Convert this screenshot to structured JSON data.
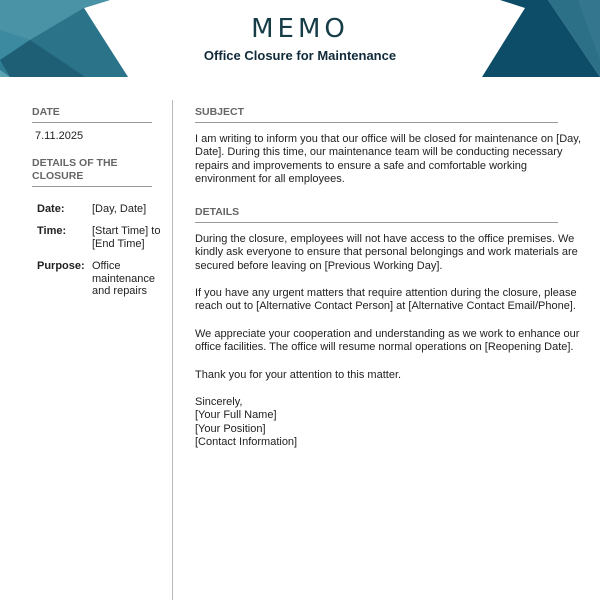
{
  "header": {
    "title": "MEMO",
    "subtitle": "Office Closure for Maintenance",
    "colors": {
      "teal": "#3a8296",
      "teal_light": "#4a93a6",
      "navy": "#0f4e68",
      "teal_dark": "#1d6279"
    }
  },
  "left": {
    "date_heading": "DATE",
    "date_value": "7.11.2025",
    "details_heading_line1": "DETAILS OF THE",
    "details_heading_line2": "CLOSURE",
    "details": [
      {
        "label": "Date:",
        "value_lines": [
          "[Day, Date]"
        ]
      },
      {
        "label": "Time:",
        "value_lines": [
          "[Start Time] to",
          "[End Time]"
        ]
      },
      {
        "label": "Purpose:",
        "value_lines": [
          "Office",
          "maintenance",
          "and repairs"
        ]
      }
    ]
  },
  "right": {
    "subject_heading": "SUBJECT",
    "subject_lines": [
      "I am writing to inform you that our office will be closed for maintenance on [Day,",
      "Date]. During this time, our maintenance team will be conducting necessary",
      "repairs and improvements to ensure a safe and comfortable working",
      "environment for all employees."
    ],
    "details_heading": "DETAILS",
    "paragraphs": [
      [
        "During the closure, employees will not have access to the office premises. We",
        "kindly ask everyone to ensure that personal belongings and work materials are",
        "secured before leaving on [Previous Working Day]."
      ],
      [
        "If you have any urgent matters that require attention during the closure, please",
        "reach out to [Alternative Contact Person] at [Alternative Contact Email/Phone]."
      ],
      [
        "We appreciate your cooperation and understanding as we work to enhance our",
        "office facilities. The office will resume normal operations on [Reopening Date]."
      ],
      [
        "Thank you for your attention to this matter."
      ],
      [
        "Sincerely,",
        "[Your Full Name]",
        "[Your Position]",
        "[Contact Information]"
      ]
    ]
  }
}
